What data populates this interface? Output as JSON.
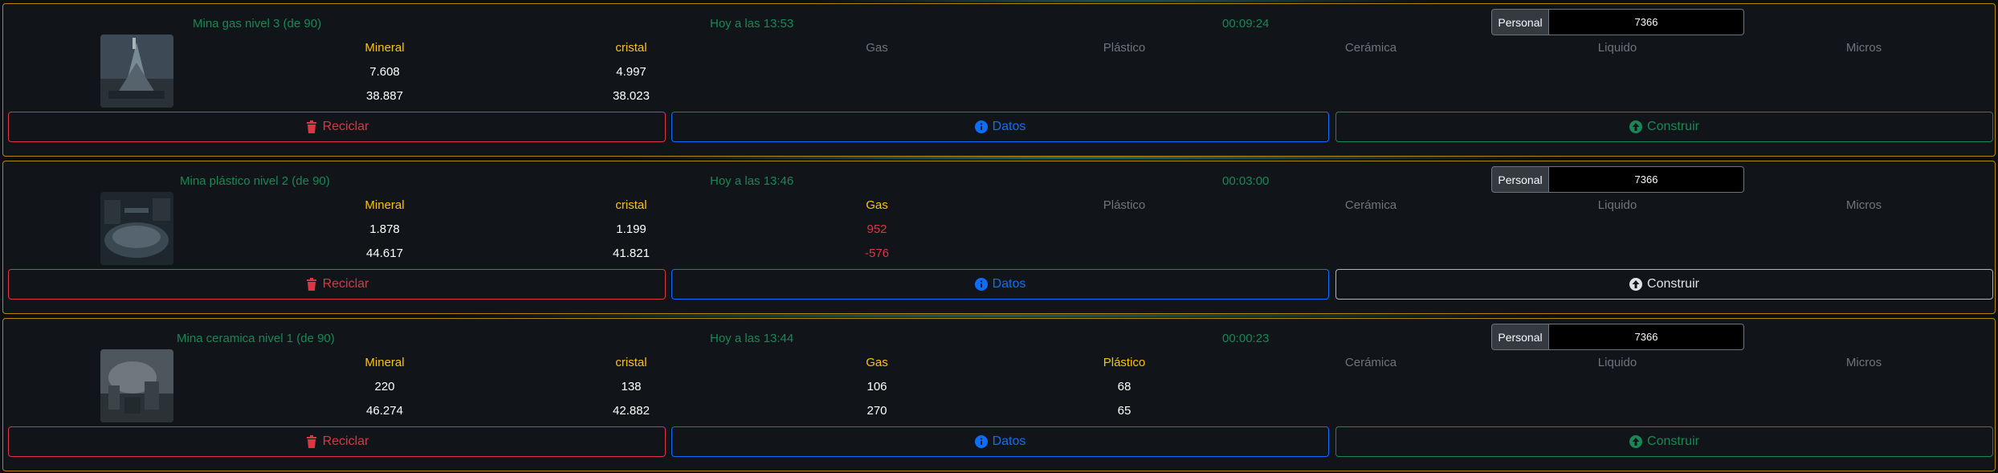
{
  "labels": {
    "personal": "Personal",
    "reciclar": "Reciclar",
    "datos": "Datos",
    "construir": "Construir"
  },
  "colors": {
    "success": "#198754",
    "danger": "#dc3545",
    "primary": "#0d6efd",
    "warning": "#ffc107",
    "muted": "#6c757d",
    "card_border": "#b8860b"
  },
  "mines": [
    {
      "title": "Mina gas nivel 3 (de 90)",
      "time": "Hoy a las 13:53",
      "timer": "00:09:24",
      "personal_value": "7366",
      "headers": [
        "Mineral",
        "cristal",
        "Gas",
        "Plástico",
        "Cerámica",
        "Liquido",
        "Micros"
      ],
      "row1": [
        "7.608",
        "4.997",
        "",
        "",
        "",
        "",
        ""
      ],
      "row2": [
        "38.887",
        "38.023",
        "",
        "",
        "",
        "",
        ""
      ],
      "construir_enabled": true
    },
    {
      "title": "Mina plástico nivel 2 (de 90)",
      "time": "Hoy a las 13:46",
      "timer": "00:03:00",
      "personal_value": "7366",
      "headers": [
        "Mineral",
        "cristal",
        "Gas",
        "Plástico",
        "Cerámica",
        "Liquido",
        "Micros"
      ],
      "row1": [
        "1.878",
        "1.199",
        "952",
        "",
        "",
        "",
        ""
      ],
      "row2": [
        "44.617",
        "41.821",
        "-576",
        "",
        "",
        "",
        ""
      ],
      "construir_enabled": false
    },
    {
      "title": "Mina ceramica nivel 1 (de 90)",
      "time": "Hoy a las 13:44",
      "timer": "00:00:23",
      "personal_value": "7366",
      "headers": [
        "Mineral",
        "cristal",
        "Gas",
        "Plástico",
        "Cerámica",
        "Liquido",
        "Micros"
      ],
      "row1": [
        "220",
        "138",
        "106",
        "68",
        "",
        "",
        ""
      ],
      "row2": [
        "46.274",
        "42.882",
        "270",
        "65",
        "",
        "",
        ""
      ],
      "construir_enabled": true
    }
  ]
}
